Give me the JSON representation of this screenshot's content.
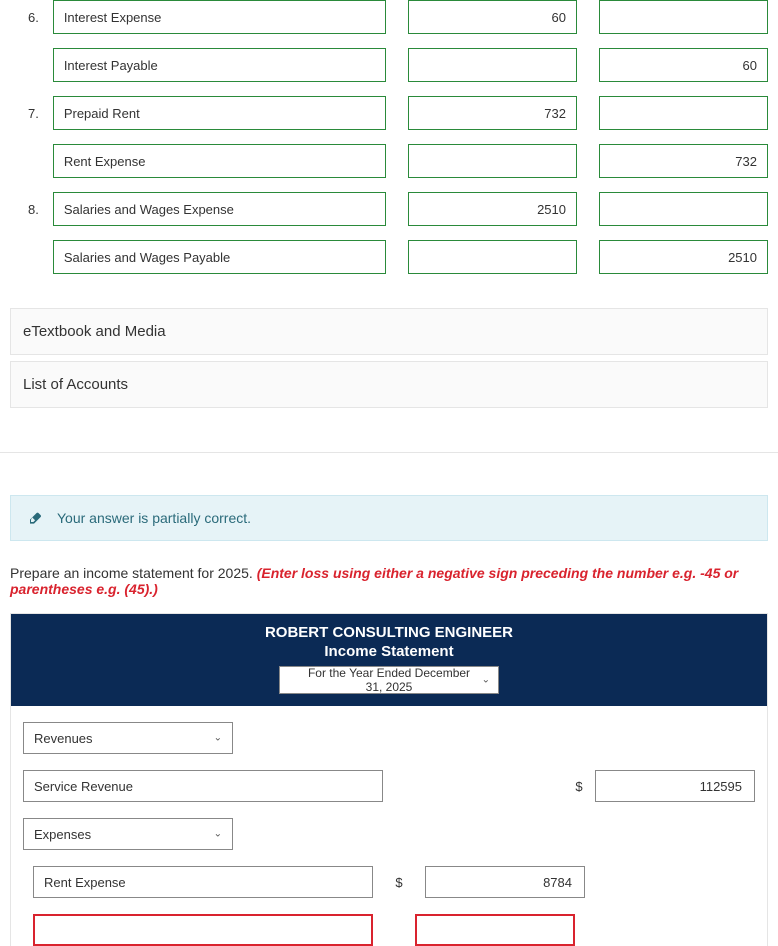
{
  "journal": [
    {
      "num": "6.",
      "account": "Interest Expense",
      "debit": "60",
      "credit": ""
    },
    {
      "num": "",
      "account": "Interest Payable",
      "debit": "",
      "credit": "60"
    },
    {
      "num": "7.",
      "account": "Prepaid Rent",
      "debit": "732",
      "credit": ""
    },
    {
      "num": "",
      "account": "Rent Expense",
      "debit": "",
      "credit": "732"
    },
    {
      "num": "8.",
      "account": "Salaries and Wages Expense",
      "debit": "2510",
      "credit": ""
    },
    {
      "num": "",
      "account": "Salaries and Wages Payable",
      "debit": "",
      "credit": "2510"
    }
  ],
  "sections": {
    "etextbook": "eTextbook and Media",
    "accounts": "List of Accounts"
  },
  "feedback": "Your answer is partially correct.",
  "instruction": {
    "plain": "Prepare an income statement for 2025. ",
    "red": "(Enter loss using either a negative sign preceding the number e.g. -45 or parentheses e.g. (45).)"
  },
  "statement": {
    "company": "ROBERT CONSULTING ENGINEER",
    "title": "Income Statement",
    "period": "For the Year Ended December 31, 2025",
    "rows": {
      "revenues_label": "Revenues",
      "service_revenue_label": "Service Revenue",
      "service_revenue_amount": "112595",
      "expenses_label": "Expenses",
      "rent_expense_label": "Rent Expense",
      "rent_expense_amount": "8784"
    }
  }
}
